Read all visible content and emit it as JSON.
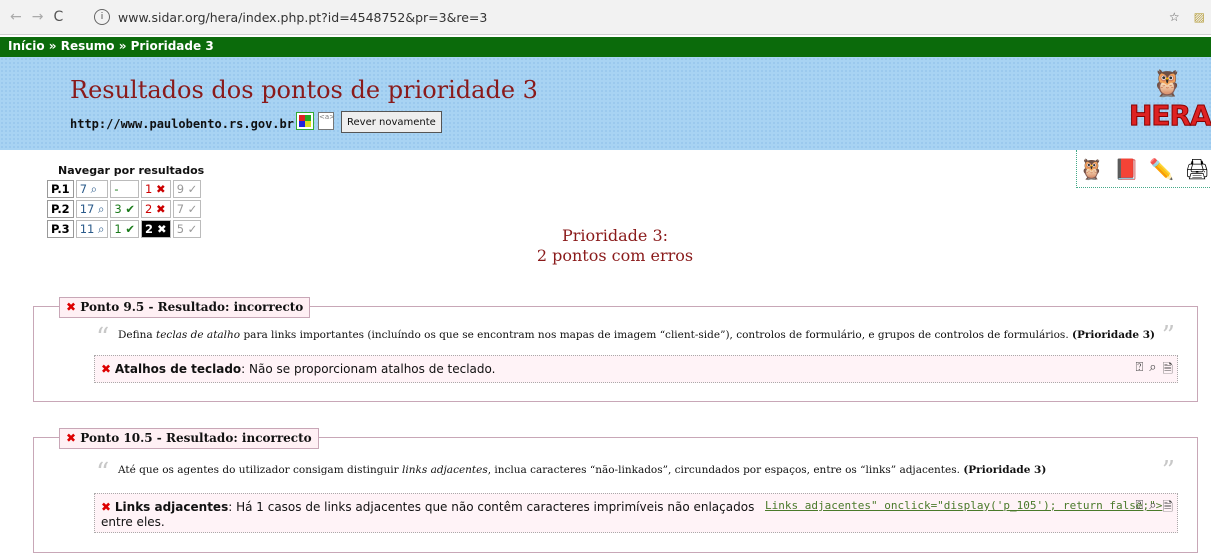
{
  "browser": {
    "url": "www.sidar.org/hera/index.php.pt?id=4548752&pr=3&re=3",
    "info_icon": "info-icon"
  },
  "breadcrumb": "Início » Resumo » Prioridade 3",
  "header": {
    "title": "Resultados dos pontos de prioridade 3",
    "site_url": "http://www.paulobento.rs.gov.br",
    "rever_button": "Rever novamente",
    "logo_text": "HERA"
  },
  "nav_results": {
    "title": "Navegar por resultados",
    "rows": [
      {
        "label": "P.1",
        "rev": "7 ⌕",
        "ok": "-",
        "err": "1 ✖",
        "na": "9 ✓"
      },
      {
        "label": "P.2",
        "rev": "17 ⌕",
        "ok": "3 ✔",
        "err": "2 ✖",
        "na": "7 ✓"
      },
      {
        "label": "P.3",
        "rev": "11 ⌕",
        "ok": "1 ✔",
        "err": "2 ✖",
        "na": "5 ✓"
      }
    ]
  },
  "summary": {
    "line1": "Prioridade 3:",
    "line2": "2 pontos com erros"
  },
  "points": [
    {
      "tab": "Ponto 9.5 - Resultado: incorrecto",
      "quote_pre": "Defina ",
      "quote_em": "teclas de atalho",
      "quote_post": " para links importantes (incluíndo os que se encontram nos mapas de imagem “client-side”), controlos de formulário, e grupos de controlos de formulários. ",
      "quote_priority": "(Prioridade 3)",
      "result_label": "Atalhos de teclado",
      "result_text": ": Não se proporcionam atalhos de teclado."
    },
    {
      "tab": "Ponto 10.5 - Resultado: incorrecto",
      "quote_pre": "Até que os agentes do utilizador consigam distinguir ",
      "quote_em": "links adjacentes",
      "quote_post": ", inclua caracteres “não-linkados”, circundados por espaços, entre os “links” adjacentes. ",
      "quote_priority": "(Prioridade 3)",
      "result_label": "Links adjacentes",
      "result_text_1": ": Há 1 casos de links adjacentes que não contêm caracteres imprimíveis não enlaçados",
      "result_text_2": "entre eles.",
      "result_link": "Links adjacentes\" onclick=\"display('p_105'); return false;\">"
    }
  ]
}
